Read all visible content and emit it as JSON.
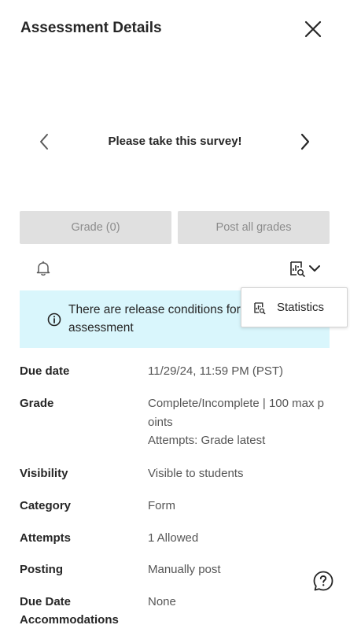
{
  "header": {
    "title": "Assessment Details"
  },
  "nav": {
    "title": "Please take this survey!"
  },
  "actions": {
    "grade_label": "Grade (0)",
    "post_label": "Post all grades"
  },
  "banner": {
    "text": "There are release conditions for this assessment"
  },
  "dropdown": {
    "items": [
      {
        "label": "Statistics",
        "icon": "statistics-icon"
      }
    ]
  },
  "details": [
    {
      "label": "Due date",
      "value": "11/29/24, 11:59 PM (PST)"
    },
    {
      "label": "Grade",
      "value": "Complete/Incomplete | 100 max points",
      "extra": "Attempts: Grade latest"
    },
    {
      "label": "Visibility",
      "value": "Visible to students"
    },
    {
      "label": "Category",
      "value": "Form"
    },
    {
      "label": "Attempts",
      "value": "1 Allowed"
    },
    {
      "label": "Posting",
      "value": "Manually post"
    },
    {
      "label": "Due Date Accommodations",
      "value": "None"
    }
  ],
  "icons": [
    "close-icon",
    "chevron-left-icon",
    "chevron-right-icon",
    "bell-icon",
    "statistics-icon",
    "chevron-down-icon",
    "info-icon",
    "help-icon"
  ],
  "colors": {
    "banner_bg": "#d9f6fc",
    "button_bg": "#e0e0e0",
    "button_text": "#8c8c8c"
  }
}
